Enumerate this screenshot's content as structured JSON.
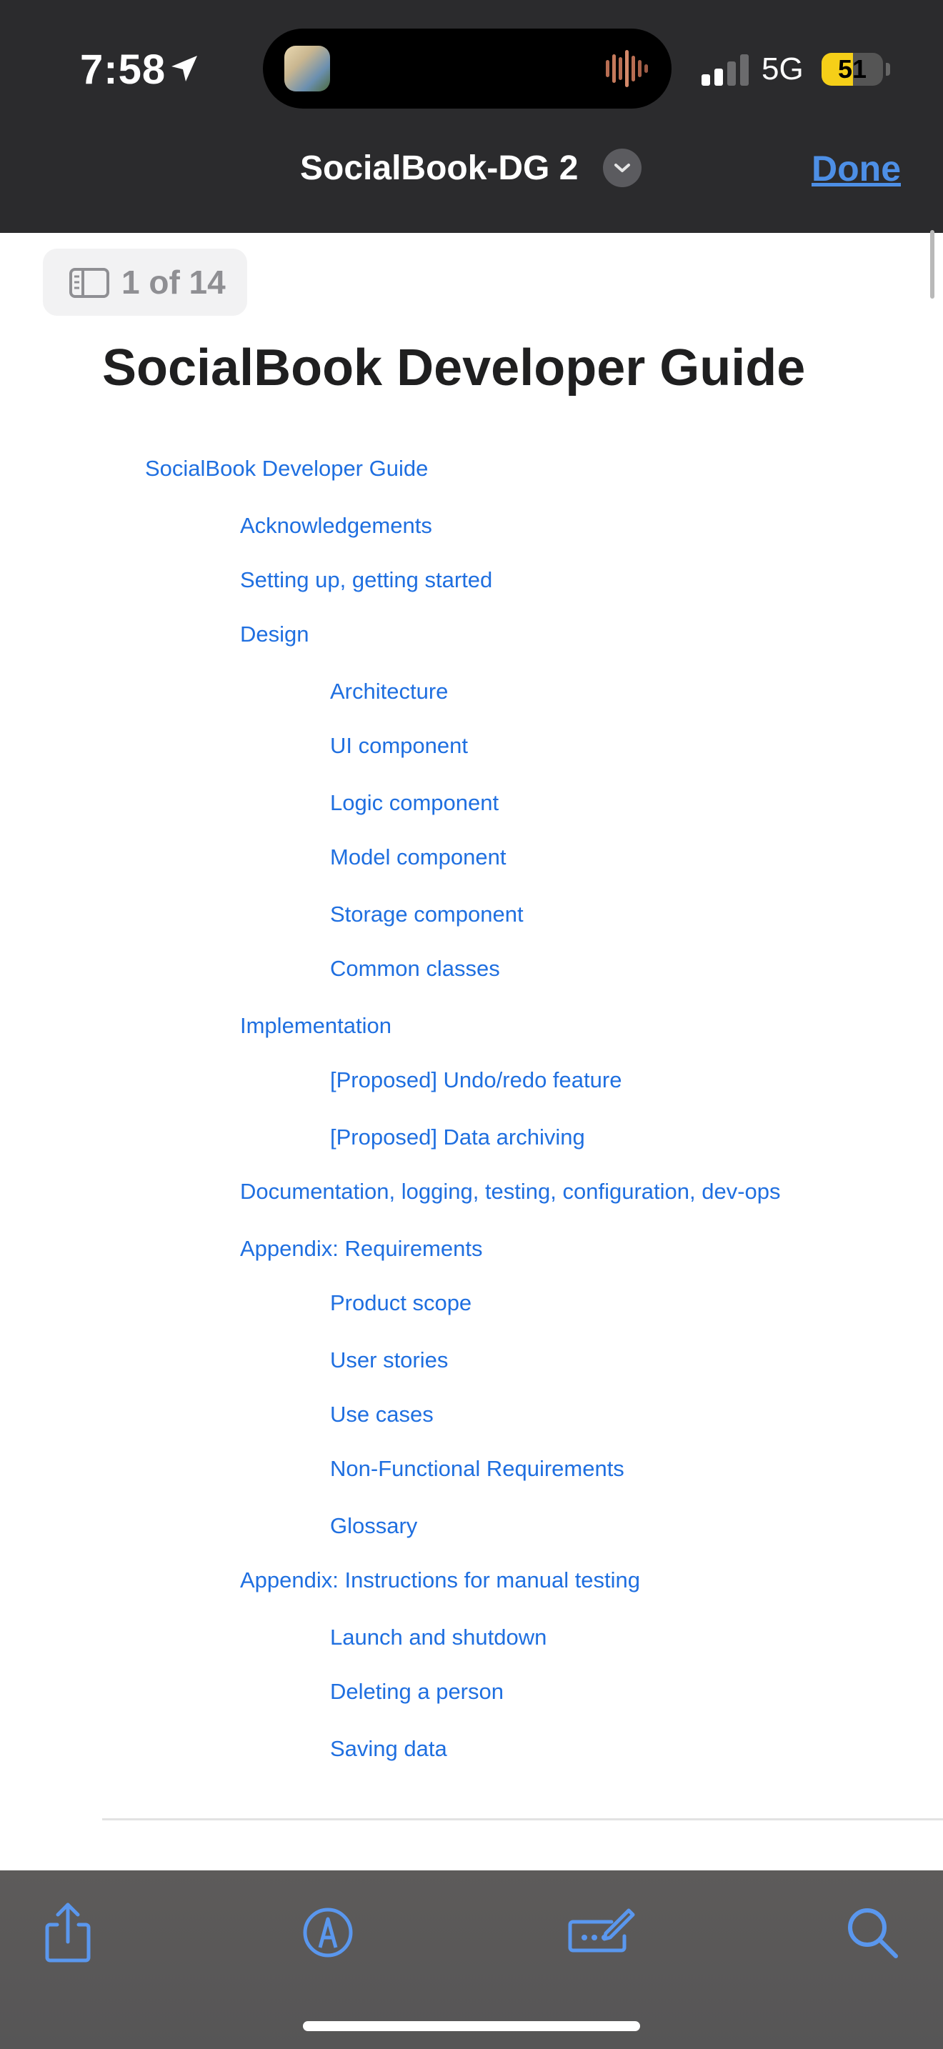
{
  "status_bar": {
    "time": "7:58",
    "network": "5G",
    "battery_level": "51",
    "battery_percent": 51,
    "icons": [
      "location-arrow-icon",
      "signal-bars-icon",
      "battery-icon"
    ]
  },
  "header": {
    "document_title": "SocialBook-DG 2",
    "done_label": "Done"
  },
  "page_indicator": {
    "text": "1 of 14"
  },
  "document": {
    "title": "SocialBook Developer Guide",
    "toc": [
      {
        "label": "SocialBook Developer Guide",
        "level": 0
      },
      {
        "label": "Acknowledgements",
        "level": 1
      },
      {
        "label": "Setting up, getting started",
        "level": 1
      },
      {
        "label": "Design",
        "level": 1
      },
      {
        "label": "Architecture",
        "level": 2
      },
      {
        "label": "UI component",
        "level": 2
      },
      {
        "label": "Logic component",
        "level": 2
      },
      {
        "label": "Model component",
        "level": 2
      },
      {
        "label": "Storage component",
        "level": 2
      },
      {
        "label": "Common classes",
        "level": 2
      },
      {
        "label": "Implementation",
        "level": 1
      },
      {
        "label": "[Proposed] Undo/redo feature",
        "level": 2
      },
      {
        "label": "[Proposed] Data archiving",
        "level": 2
      },
      {
        "label": "Documentation, logging, testing, configuration, dev-ops",
        "level": 1
      },
      {
        "label": "Appendix: Requirements",
        "level": 1
      },
      {
        "label": "Product scope",
        "level": 2
      },
      {
        "label": "User stories",
        "level": 2
      },
      {
        "label": "Use cases",
        "level": 2
      },
      {
        "label": "Non-Functional Requirements",
        "level": 2
      },
      {
        "label": "Glossary",
        "level": 2
      },
      {
        "label": "Appendix: Instructions for manual testing",
        "level": 1
      },
      {
        "label": "Launch and shutdown",
        "level": 2
      },
      {
        "label": "Deleting a person",
        "level": 2
      },
      {
        "label": "Saving data",
        "level": 2
      }
    ]
  },
  "toolbar": {
    "items": [
      "share-icon",
      "markup-icon",
      "form-fill-icon",
      "search-icon"
    ]
  },
  "colors": {
    "link": "#1f6fe0",
    "accent": "#4d8fe6",
    "header_bg": "#2b2b2d",
    "toolbar_bg": "#5a5959",
    "battery": "#f5cf18"
  }
}
